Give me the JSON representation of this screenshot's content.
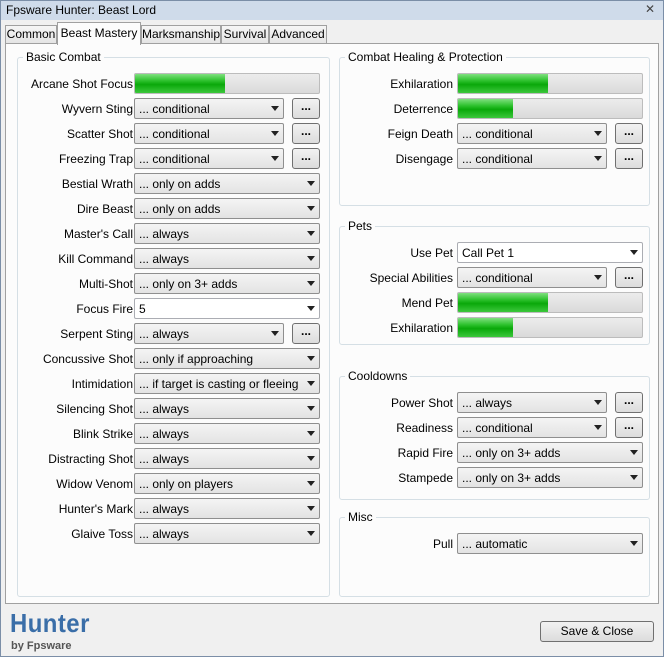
{
  "window": {
    "title": "Fpsware Hunter: Beast Lord",
    "close_glyph": "✕"
  },
  "tabs": [
    {
      "label": "Common",
      "active": false
    },
    {
      "label": "Beast Mastery",
      "active": true
    },
    {
      "label": "Marksmanship",
      "active": false
    },
    {
      "label": "Survival",
      "active": false
    },
    {
      "label": "Advanced",
      "active": false
    }
  ],
  "basic_combat": {
    "title": "Basic Combat",
    "arcane_shot_focus": {
      "label": "Arcane Shot Focus",
      "fill_fraction": 0.49
    },
    "rows": [
      {
        "label": "Wyvern Sting",
        "value": "... conditional",
        "has_button": true
      },
      {
        "label": "Scatter Shot",
        "value": "... conditional",
        "has_button": true
      },
      {
        "label": "Freezing Trap",
        "value": "... conditional",
        "has_button": true
      },
      {
        "label": "Bestial Wrath",
        "value": "... only on adds",
        "has_button": false
      },
      {
        "label": "Dire Beast",
        "value": "... only on adds",
        "has_button": false
      },
      {
        "label": "Master's Call",
        "value": "... always",
        "has_button": false
      },
      {
        "label": "Kill Command",
        "value": "... always",
        "has_button": false
      },
      {
        "label": "Multi-Shot",
        "value": "... only on 3+ adds",
        "has_button": false
      },
      {
        "label": "Focus Fire",
        "value": "5",
        "has_button": false
      },
      {
        "label": "Serpent Sting",
        "value": "... always",
        "has_button": true
      },
      {
        "label": "Concussive Shot",
        "value": "... only if approaching",
        "has_button": false
      },
      {
        "label": "Intimidation",
        "value": "... if target is casting or fleeing",
        "has_button": false
      },
      {
        "label": "Silencing Shot",
        "value": "... always",
        "has_button": false
      },
      {
        "label": "Blink Strike",
        "value": "... always",
        "has_button": false
      },
      {
        "label": "Distracting Shot",
        "value": "... always",
        "has_button": false
      },
      {
        "label": "Widow Venom",
        "value": "... only on players",
        "has_button": false
      },
      {
        "label": "Hunter's Mark",
        "value": "... always",
        "has_button": false
      },
      {
        "label": "Glaive Toss",
        "value": "... always",
        "has_button": false
      }
    ]
  },
  "healing": {
    "title": "Combat Healing & Protection",
    "exhilaration": {
      "label": "Exhilaration",
      "fill_fraction": 0.49
    },
    "deterrence": {
      "label": "Deterrence",
      "fill_fraction": 0.3
    },
    "feign_death": {
      "label": "Feign Death",
      "value": "... conditional"
    },
    "disengage": {
      "label": "Disengage",
      "value": "... conditional"
    }
  },
  "pets": {
    "title": "Pets",
    "use_pet": {
      "label": "Use Pet",
      "value": "Call Pet 1"
    },
    "special_abilities": {
      "label": "Special Abilities",
      "value": "... conditional"
    },
    "mend_pet": {
      "label": "Mend Pet",
      "fill_fraction": 0.49
    },
    "exhilaration": {
      "label": "Exhilaration",
      "fill_fraction": 0.3
    }
  },
  "cooldowns": {
    "title": "Cooldowns",
    "power_shot": {
      "label": "Power Shot",
      "value": "... always"
    },
    "readiness": {
      "label": "Readiness",
      "value": "... conditional"
    },
    "rapid_fire": {
      "label": "Rapid Fire",
      "value": "... only on 3+ adds"
    },
    "stampede": {
      "label": "Stampede",
      "value": "... only on 3+ adds"
    }
  },
  "misc": {
    "title": "Misc",
    "pull": {
      "label": "Pull",
      "value": "... automatic"
    }
  },
  "footer": {
    "logo_title": "Hunter",
    "logo_sub": "by Fpsware",
    "save_close_label": "Save & Close",
    "dots_label": "..."
  },
  "colors": {
    "progress_green": "#1fb51f",
    "logo_blue": "#3a6ea8",
    "titlebar": "#cfdbea"
  }
}
